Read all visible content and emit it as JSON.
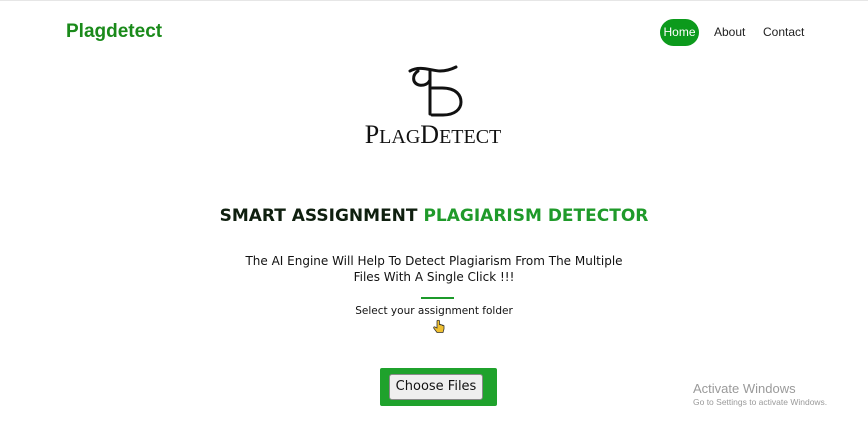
{
  "header": {
    "brand": "Plagdetect",
    "nav": [
      {
        "label": "Home",
        "active": true
      },
      {
        "label": "About",
        "active": false
      },
      {
        "label": "Contact",
        "active": false
      }
    ]
  },
  "logo": {
    "text": "PlagDetect"
  },
  "main": {
    "headline_part1": "SMART ASSIGNMENT ",
    "headline_part2": "PLAGIARISM DETECTOR",
    "subtitle": "The AI Engine Will Help To Detect Plagiarism From The Multiple Files With A Single Click !!!",
    "hint": "Select your assignment folder",
    "upload_button": "Choose Files"
  },
  "watermark": {
    "title": "Activate Windows",
    "subtitle": "Go to Settings to activate Windows."
  },
  "colors": {
    "brand_green": "#1a8a1a",
    "active_nav_bg": "#0c9a1c",
    "accent_green": "#1f9a2a",
    "upload_frame": "#1fa22c"
  },
  "icons": [
    "plagdetect-logo",
    "hand-pointer-cursor-icon"
  ]
}
